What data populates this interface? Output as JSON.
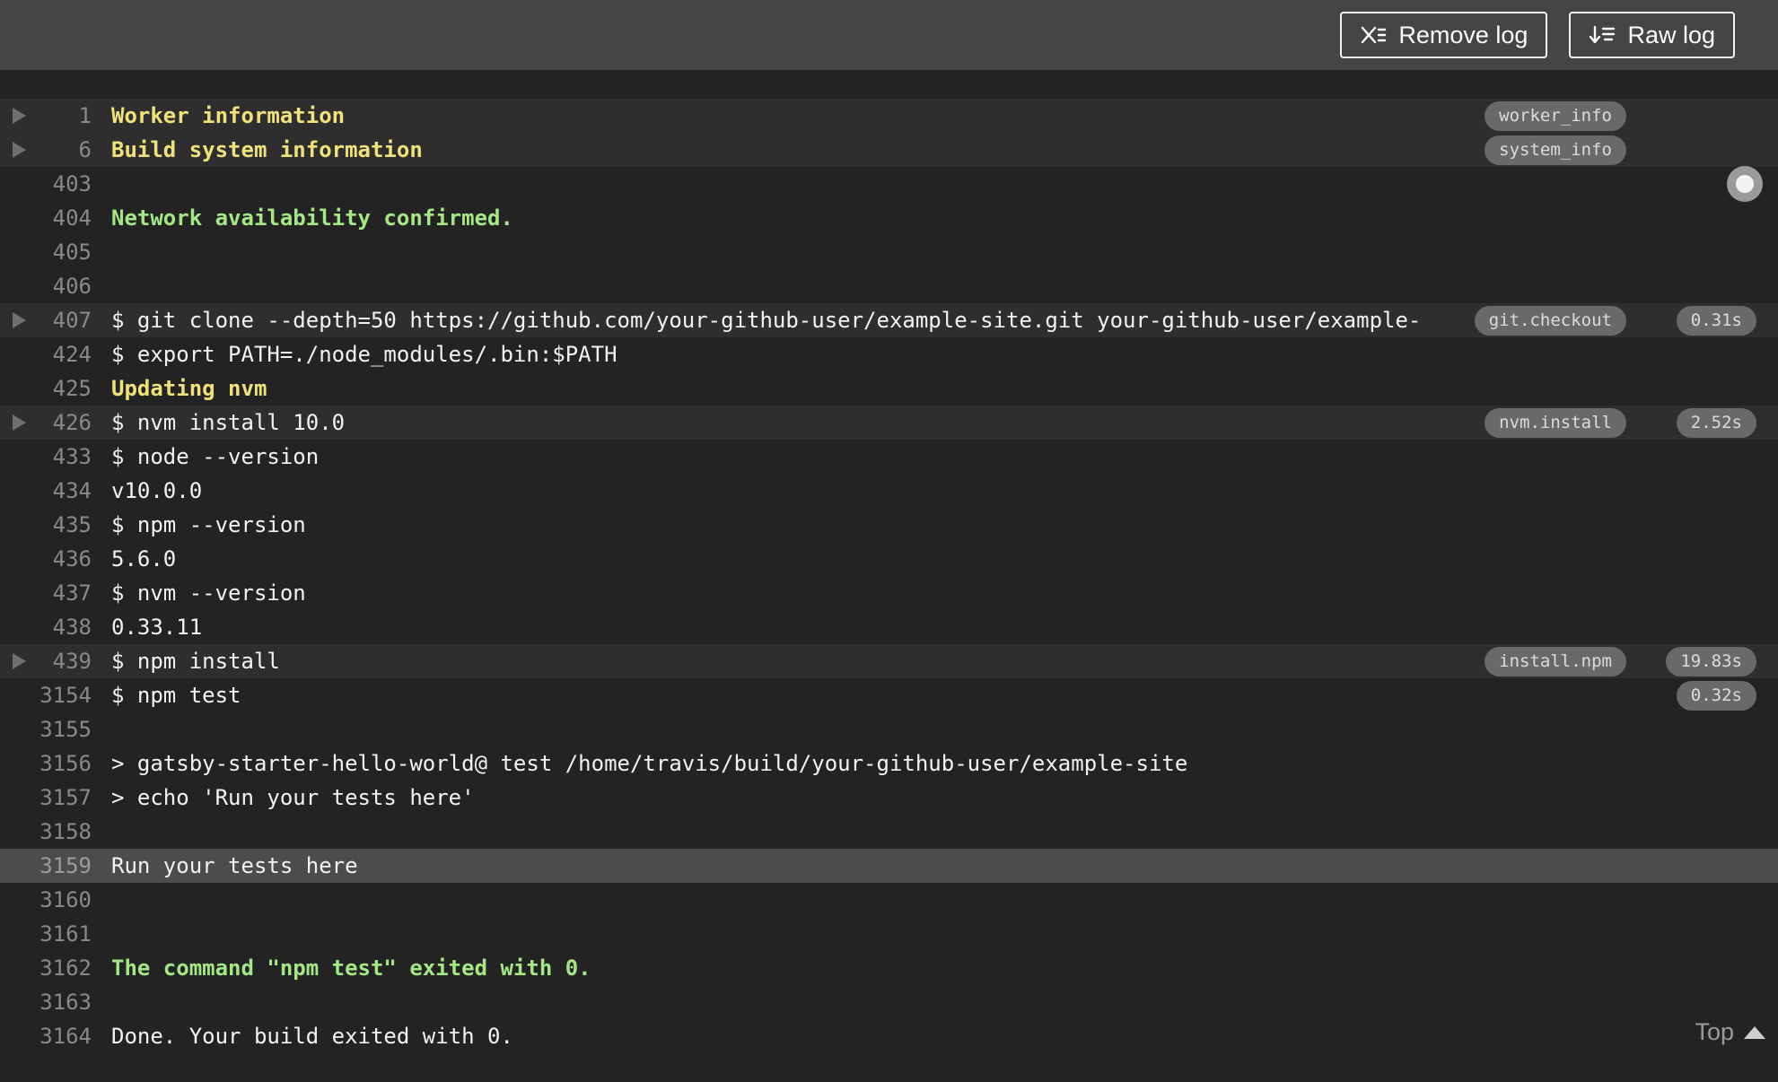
{
  "toolbar": {
    "remove_log_label": "Remove log",
    "raw_log_label": "Raw log",
    "icons": {
      "remove_log": "x-list-icon",
      "raw_log": "arrow-down-list-icon"
    }
  },
  "log": {
    "rows": [
      {
        "num": "1",
        "text": "Worker information",
        "style": "yellow",
        "fold": true,
        "badge": "worker_info"
      },
      {
        "num": "6",
        "text": "Build system information",
        "style": "yellow",
        "fold": true,
        "badge": "system_info"
      },
      {
        "num": "403",
        "text": ""
      },
      {
        "num": "404",
        "text": "Network availability confirmed.",
        "style": "green"
      },
      {
        "num": "405",
        "text": ""
      },
      {
        "num": "406",
        "text": ""
      },
      {
        "num": "407",
        "text": "$ git clone --depth=50 https://github.com/your-github-user/example-site.git your-github-user/example-",
        "fold": true,
        "badge": "git.checkout",
        "duration": "0.31s"
      },
      {
        "num": "424",
        "text": "$ export PATH=./node_modules/.bin:$PATH"
      },
      {
        "num": "425",
        "text": "Updating nvm",
        "style": "yellow"
      },
      {
        "num": "426",
        "text": "$ nvm install 10.0",
        "fold": true,
        "badge": "nvm.install",
        "duration": "2.52s"
      },
      {
        "num": "433",
        "text": "$ node --version"
      },
      {
        "num": "434",
        "text": "v10.0.0"
      },
      {
        "num": "435",
        "text": "$ npm --version"
      },
      {
        "num": "436",
        "text": "5.6.0"
      },
      {
        "num": "437",
        "text": "$ nvm --version"
      },
      {
        "num": "438",
        "text": "0.33.11"
      },
      {
        "num": "439",
        "text": "$ npm install",
        "fold": true,
        "badge": "install.npm",
        "duration": "19.83s"
      },
      {
        "num": "3154",
        "text": "$ npm test",
        "duration": "0.32s"
      },
      {
        "num": "3155",
        "text": ""
      },
      {
        "num": "3156",
        "text": "> gatsby-starter-hello-world@ test /home/travis/build/your-github-user/example-site"
      },
      {
        "num": "3157",
        "text": "> echo 'Run your tests here'"
      },
      {
        "num": "3158",
        "text": ""
      },
      {
        "num": "3159",
        "text": "Run your tests here",
        "selected": true
      },
      {
        "num": "3160",
        "text": ""
      },
      {
        "num": "3161",
        "text": ""
      },
      {
        "num": "3162",
        "text": "The command \"npm test\" exited with 0.",
        "style": "green"
      },
      {
        "num": "3163",
        "text": ""
      },
      {
        "num": "3164",
        "text": "Done. Your build exited with 0."
      }
    ],
    "top_link_label": "Top",
    "icons": {
      "fold_toggle": "triangle-right-icon",
      "follow": "circle-dot-icon",
      "top": "caret-up-icon"
    }
  },
  "colors": {
    "header_bg": "#454545",
    "log_bg": "#232323",
    "fold_row_bg": "#2e2e2e",
    "selected_row_bg": "#4c4c4c",
    "text": "#f2f2f2",
    "line_number": "#898989",
    "yellow": "#f0e17d",
    "green": "#a5e687",
    "badge_bg": "#696969",
    "badge_text": "#dcdcdc"
  }
}
